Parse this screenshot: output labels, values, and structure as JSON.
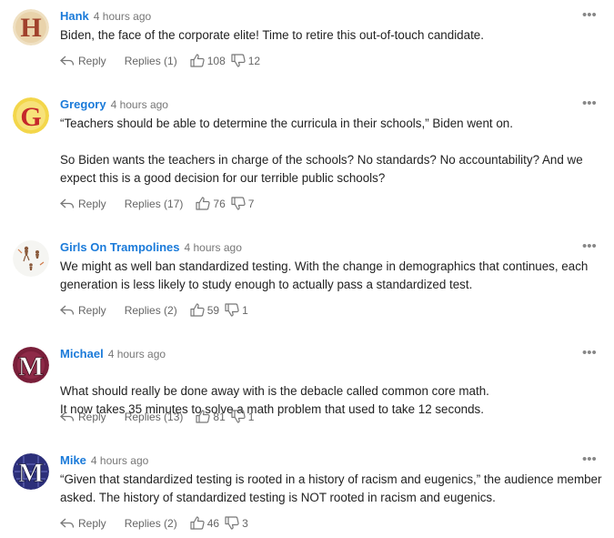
{
  "comments": [
    {
      "author": "Hank",
      "time": "4 hours ago",
      "avatar_letter": "H",
      "avatar_style": "parchment",
      "paragraphs": [
        "Biden, the face of the corporate elite! Time to retire this out-of-touch candidate."
      ],
      "reply_label": "Reply",
      "replies_label": "Replies (1)",
      "likes": "108",
      "dislikes": "12"
    },
    {
      "author": "Gregory",
      "time": "4 hours ago",
      "avatar_letter": "G",
      "avatar_style": "gold",
      "paragraphs": [
        "“Teachers should be able to determine the curricula in their schools,” Biden went on.",
        "So Biden wants the teachers in charge of the schools? No standards? No accountability? And we expect this is a good decision for our terrible public schools?"
      ],
      "reply_label": "Reply",
      "replies_label": "Replies (17)",
      "likes": "76",
      "dislikes": "7"
    },
    {
      "author": "Girls On Trampolines",
      "time": "4 hours ago",
      "avatar_letter": "",
      "avatar_style": "figures",
      "paragraphs": [
        "We might as well ban standardized testing. With the change in demographics that continues, each generation is less likely to study enough to actually pass a standardized test."
      ],
      "reply_label": "Reply",
      "replies_label": "Replies (2)",
      "likes": "59",
      "dislikes": "1"
    },
    {
      "author": "Michael",
      "time": "4 hours ago",
      "avatar_letter": "M",
      "avatar_style": "maroon",
      "paragraphs": [
        "What should really be done away with is the debacle called common core math.\nIt now takes 35 minutes to solve a math problem that used to take 12 seconds."
      ],
      "reply_label": "Reply",
      "replies_label": "Replies (13)",
      "likes": "81",
      "dislikes": "1"
    },
    {
      "author": "Mike",
      "time": "4 hours ago",
      "avatar_letter": "M",
      "avatar_style": "navy",
      "paragraphs": [
        "“Given that standardized testing is rooted in a history of racism and eugenics,” the audience member asked. The history of standardized testing is NOT rooted in racism and eugenics."
      ],
      "reply_label": "Reply",
      "replies_label": "Replies (2)",
      "likes": "46",
      "dislikes": "3"
    }
  ],
  "icons": {
    "more": "ellipsis-icon",
    "reply": "reply-arrow-icon",
    "like": "thumbs-up-icon",
    "dislike": "thumbs-down-icon"
  },
  "colors": {
    "author": "#1a7ad9",
    "meta": "#777777",
    "action": "#666666"
  }
}
